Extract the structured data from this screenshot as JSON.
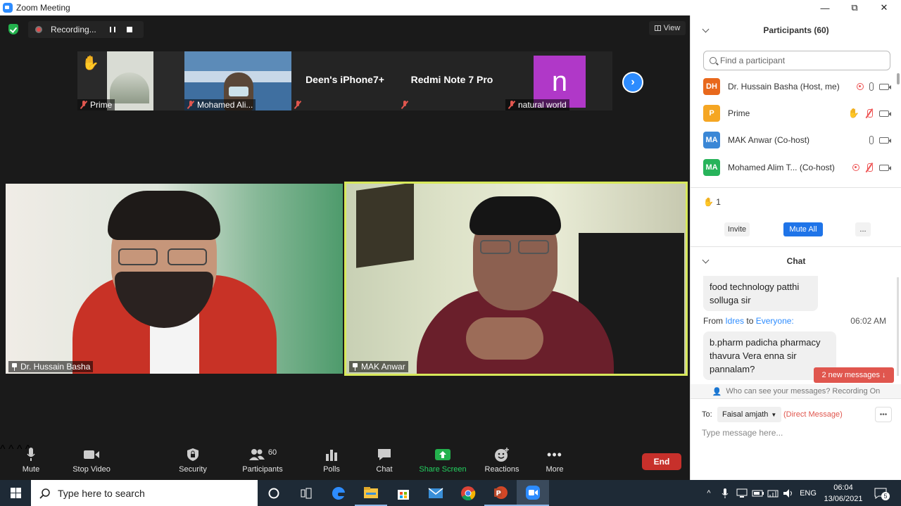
{
  "window": {
    "title": "Zoom Meeting",
    "minimize": "—",
    "maximize": "⧉",
    "close": "✕"
  },
  "meeting": {
    "recording_label": "Recording...",
    "view_label": "View",
    "thumbnails": [
      {
        "name": "Prime",
        "big_text": "",
        "hand": "✋"
      },
      {
        "name": "Mohamed Ali...",
        "big_text": ""
      },
      {
        "name": "",
        "big_text": "Deen's iPhone7+"
      },
      {
        "name": "",
        "big_text": "Redmi Note 7 Pro"
      },
      {
        "name": "natural world",
        "big_text": "",
        "avatar_letter": "n"
      }
    ],
    "next_arrow": "›",
    "tiles": [
      {
        "name": "Dr. Hussain Basha"
      },
      {
        "name": "MAK Anwar"
      }
    ]
  },
  "toolbar": {
    "mute": "Mute",
    "stop_video": "Stop Video",
    "security": "Security",
    "participants": "Participants",
    "participants_count": "60",
    "polls": "Polls",
    "chat": "Chat",
    "share_screen": "Share Screen",
    "reactions": "Reactions",
    "more": "More",
    "end": "End"
  },
  "participants_panel": {
    "title": "Participants (60)",
    "find_placeholder": "Find a participant",
    "rows": [
      {
        "initials": "DH",
        "name": "Dr. Hussain Basha (Host, me)",
        "color": "#e8681c"
      },
      {
        "initials": "P",
        "name": "Prime",
        "color": "#f5a623"
      },
      {
        "initials": "MA",
        "name": "MAK Anwar (Co-host)",
        "color": "#3a87d6"
      },
      {
        "initials": "MA",
        "name": "Mohamed Alim T...  (Co-host)",
        "color": "#27b35a"
      }
    ],
    "raised_hands": "✋ 1",
    "invite": "Invite",
    "mute_all": "Mute All",
    "more": "..."
  },
  "chat_panel": {
    "title": "Chat",
    "messages": [
      {
        "text_line1": "food technology patthi",
        "text_line2": "solluga sir"
      },
      {
        "text_line1": "b.pharm padicha pharmacy",
        "text_line2": "thavura Vera enna sir",
        "text_line3": "pannalam?"
      }
    ],
    "from_prefix": "From",
    "from_sender": "Idres",
    "from_to": "to",
    "from_recipient": "Everyone:",
    "from_time": "06:02 AM",
    "new_messages": "2 new messages ↓",
    "who_can_see": "Who can see your messages? Recording On",
    "to_label": "To:",
    "to_recipient": "Faisal amjath",
    "direct": "(Direct Message)",
    "input_placeholder": "Type message here..."
  },
  "taskbar": {
    "search_placeholder": "Type here to search",
    "language": "ENG",
    "time": "06:04",
    "date": "13/06/2021",
    "notifications": "5"
  }
}
